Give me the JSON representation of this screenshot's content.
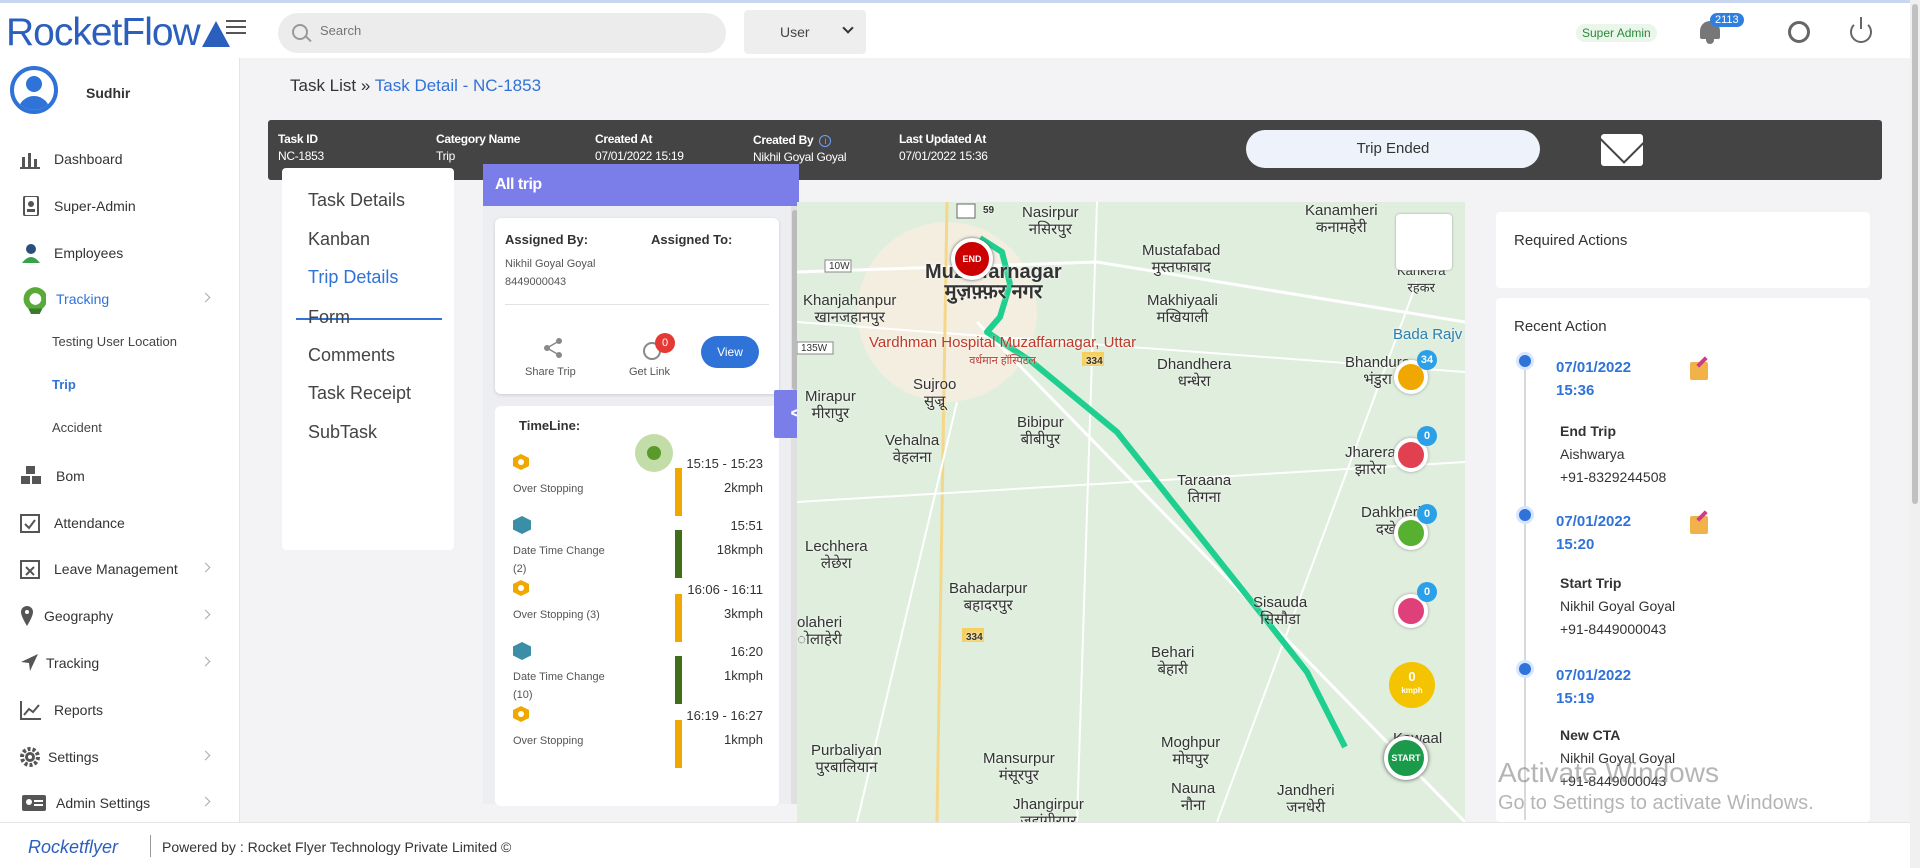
{
  "app": {
    "logo": "RocketFlow",
    "search_placeholder": "Search",
    "user_select": "User",
    "role_badge": "Super Admin",
    "notification_count": "2113"
  },
  "sidebar": {
    "user": "Sudhir",
    "items": [
      {
        "label": "Dashboard",
        "icon": "bar-chart-icon"
      },
      {
        "label": "Super-Admin",
        "icon": "badge-icon"
      },
      {
        "label": "Employees",
        "icon": "employee-icon"
      },
      {
        "label": "Tracking",
        "icon": "tracking-icon",
        "active": true
      },
      {
        "label": "Bom",
        "icon": "cubes-icon"
      },
      {
        "label": "Attendance",
        "icon": "calendar-check-icon"
      },
      {
        "label": "Leave Management",
        "icon": "calendar-x-icon"
      },
      {
        "label": "Geography",
        "icon": "location-pin-icon"
      },
      {
        "label": "Tracking",
        "icon": "navigation-arrow-icon"
      },
      {
        "label": "Reports",
        "icon": "line-chart-icon"
      },
      {
        "label": "Settings",
        "icon": "gear-icon"
      },
      {
        "label": "Admin Settings",
        "icon": "id-card-icon"
      }
    ],
    "subitems": [
      "Testing User Location",
      "Trip",
      "Accident"
    ]
  },
  "breadcrumb": {
    "parent": "Task List",
    "separator": "»",
    "current": "Task Detail - NC-1853"
  },
  "info": {
    "task_id_label": "Task ID",
    "task_id": "NC-1853",
    "category_label": "Category Name",
    "category": "Trip",
    "created_at_label": "Created At",
    "created_at": "07/01/2022 15:19",
    "created_by_label": "Created By",
    "created_by": "Nikhil Goyal Goyal",
    "updated_label": "Last Updated At",
    "updated": "07/01/2022 15:36",
    "status": "Trip Ended"
  },
  "tabs": [
    "Task Details",
    "Kanban",
    "Trip Details",
    "Form",
    "Comments",
    "Task Receipt",
    "SubTask"
  ],
  "trip": {
    "header": "All trip",
    "assigned_by_label": "Assigned By:",
    "assigned_to_label": "Assigned To:",
    "assigned_name": "Nikhil Goyal Goyal",
    "assigned_phone": "8449000043",
    "share_label": "Share Trip",
    "link_label": "Get Link",
    "link_count": "0",
    "view_label": "View",
    "collapse": "<"
  },
  "timeline": {
    "title": "TimeLine:",
    "items": [
      {
        "label": "Over Stopping",
        "time": "15:15 - 15:23",
        "speed": "2kmph",
        "icon": "hexagon-icon",
        "color": "#f0a800"
      },
      {
        "label": "Date Time Change",
        "sub": "(2)",
        "time": "15:51",
        "speed": "18kmph",
        "icon": "calendar-icon",
        "color": "#3f6f1a"
      },
      {
        "label": "Over Stopping (3)",
        "time": "16:06 - 16:11",
        "speed": "3kmph",
        "icon": "hexagon-icon",
        "color": "#f0a800"
      },
      {
        "label": "Date Time Change",
        "sub": "(10)",
        "time": "16:20",
        "speed": "1kmph",
        "icon": "calendar-icon",
        "color": "#3f6f1a"
      },
      {
        "label": "Over Stopping",
        "time": "16:19 - 16:27",
        "speed": "1kmph",
        "icon": "hexagon-icon",
        "color": "#f0a800"
      }
    ]
  },
  "map": {
    "places": [
      {
        "name": "Nasirpur",
        "local": "नसिरपुर"
      },
      {
        "name": "Mustafabad",
        "local": "मुस्तफाबाद"
      },
      {
        "name": "Kanamheri",
        "local": "कनामहेरी"
      },
      {
        "name": "Muzaffarnagar",
        "local": "मुज़फ़्फ़र नगर"
      },
      {
        "name": "Khanjahanpur",
        "local": "खानजहानपुर"
      },
      {
        "name": "Makhiyaali",
        "local": "मखियाली"
      },
      {
        "name": "Kankera",
        "local": "रहकर"
      },
      {
        "name": "Vardhman Hospital Muzaffarnagar, Uttar",
        "local": "वर्धमान हॉस्पिटल"
      },
      {
        "name": "Dhandhera",
        "local": "धन्धेरा"
      },
      {
        "name": "Bhandura",
        "local": "भंडुरा"
      },
      {
        "name": "Bada Rajv",
        "local": ""
      },
      {
        "name": "Sujroo",
        "local": "सुज्रू"
      },
      {
        "name": "Mirapur",
        "local": "मीरापुर"
      },
      {
        "name": "Bibipur",
        "local": "बीबीपुर"
      },
      {
        "name": "Vehalna",
        "local": "वेहलना"
      },
      {
        "name": "Jharera",
        "local": "झारेरा"
      },
      {
        "name": "Taraana",
        "local": "तिगना"
      },
      {
        "name": "Dahkheri",
        "local": "दखेरी"
      },
      {
        "name": "Lechhera",
        "local": "लेछेरा"
      },
      {
        "name": "Bahadarpur",
        "local": "बहादरपुर"
      },
      {
        "name": "Sisauda",
        "local": "सिसौडा"
      },
      {
        "name": "olaheri",
        "local": "ोलाहेरी"
      },
      {
        "name": "Behari",
        "local": "बेहारी"
      },
      {
        "name": "Purbaliyan",
        "local": "पुरबालियान"
      },
      {
        "name": "Mansurpur",
        "local": "मंसूरपुर"
      },
      {
        "name": "Moghpur",
        "local": "मोघपुर"
      },
      {
        "name": "Kawaal",
        "local": ""
      },
      {
        "name": "Nauna",
        "local": "नौना"
      },
      {
        "name": "Jandheri",
        "local": "जनधेरी"
      },
      {
        "name": "Jhangirpur",
        "local": "जहांगीरपुर"
      }
    ],
    "roads": [
      "59",
      "10W",
      "135W",
      "334",
      "334"
    ],
    "end_label": "END",
    "start_label": "START",
    "marker_counts": [
      "34",
      "0",
      "0",
      "0"
    ],
    "speed_value": "0",
    "speed_unit": "kmph",
    "route_color": "#1fcf8f"
  },
  "required_actions": {
    "title": "Required Actions"
  },
  "recent": {
    "title": "Recent Action",
    "items": [
      {
        "date": "07/01/2022",
        "time": "15:36",
        "action": "End Trip",
        "name": "Aishwarya",
        "phone": "+91-8329244508"
      },
      {
        "date": "07/01/2022",
        "time": "15:20",
        "action": "Start Trip",
        "name": "Nikhil Goyal Goyal",
        "phone": "+91-8449000043"
      },
      {
        "date": "07/01/2022",
        "time": "15:19",
        "action": "New CTA",
        "name": "Nikhil Goyal Goyal",
        "phone": "+91-8449000043"
      }
    ]
  },
  "watermark": {
    "line1": "Activate Windows",
    "line2": "Go to Settings to activate Windows."
  },
  "footer": {
    "logo": "Rocketflyer",
    "powered": "Powered by : Rocket Flyer Technology Private Limited ©"
  }
}
